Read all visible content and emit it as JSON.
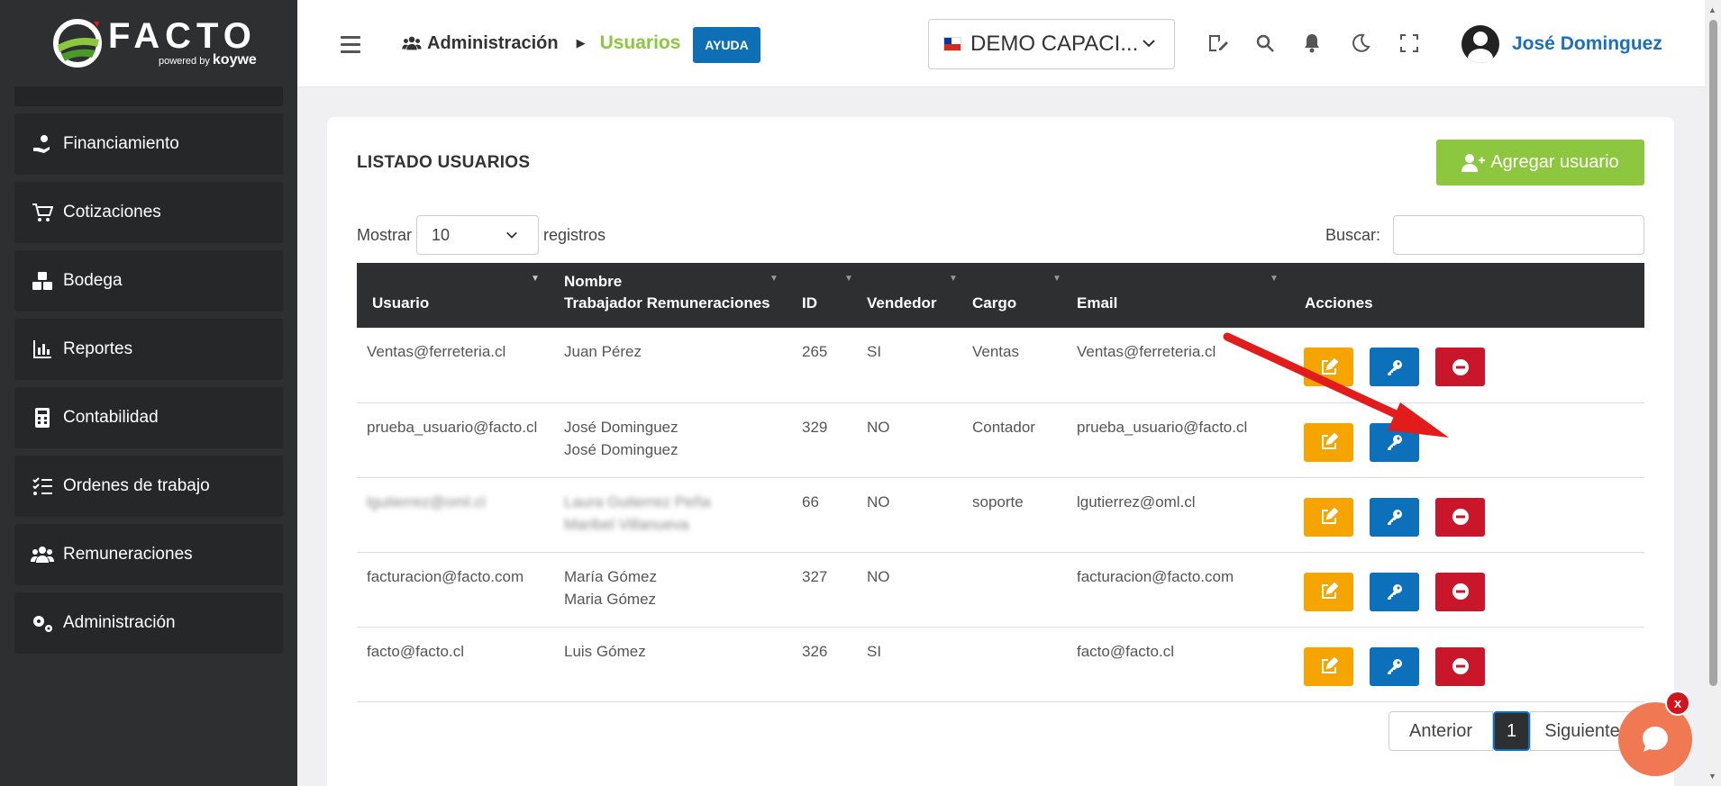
{
  "logo": {
    "name": "FACTO",
    "powered": "powered by",
    "brand": "koywe"
  },
  "sidebar": {
    "items": [
      {
        "label": "Financiamiento",
        "icon": "hand-money-icon"
      },
      {
        "label": "Cotizaciones",
        "icon": "cart-icon"
      },
      {
        "label": "Bodega",
        "icon": "boxes-icon"
      },
      {
        "label": "Reportes",
        "icon": "chart-icon"
      },
      {
        "label": "Contabilidad",
        "icon": "calculator-icon"
      },
      {
        "label": "Ordenes de trabajo",
        "icon": "list-check-icon"
      },
      {
        "label": "Remuneraciones",
        "icon": "users-icon"
      },
      {
        "label": "Administración",
        "icon": "gears-icon"
      }
    ]
  },
  "header": {
    "breadcrumb": {
      "parent": "Administración",
      "current": "Usuarios"
    },
    "help_label": "AYUDA",
    "company": "DEMO CAPACI...",
    "user_name": "José Dominguez"
  },
  "main": {
    "title": "LISTADO USUARIOS",
    "add_label": "Agregar usuario",
    "show_prefix": "Mostrar",
    "show_value": "10",
    "show_suffix": "registros",
    "search_label": "Buscar:",
    "columns": [
      "Usuario",
      "Nombre",
      "Trabajador Remuneraciones",
      "ID",
      "Vendedor",
      "Cargo",
      "Email",
      "Acciones"
    ],
    "rows": [
      {
        "usuario": "Ventas@ferreteria.cl",
        "nombre": "Juan Pérez",
        "trabajador": "",
        "id": "265",
        "vendedor": "SI",
        "cargo": "Ventas",
        "email": "Ventas@ferreteria.cl",
        "blurred": false,
        "deletable": true
      },
      {
        "usuario": "prueba_usuario@facto.cl",
        "nombre": "José Dominguez",
        "trabajador": "José Dominguez",
        "id": "329",
        "vendedor": "NO",
        "cargo": "Contador",
        "email": "prueba_usuario@facto.cl",
        "blurred": false,
        "deletable": false
      },
      {
        "usuario": "lgutierrez@oml.cl",
        "nombre": "Laura Gutierrez Peña",
        "trabajador": "Maribel Villanueva",
        "id": "66",
        "vendedor": "NO",
        "cargo": "soporte",
        "email": "lgutierrez@oml.cl",
        "blurred": true,
        "deletable": true
      },
      {
        "usuario": "facturacion@facto.com",
        "nombre": "María Gómez",
        "trabajador": "Maria Gómez",
        "id": "327",
        "vendedor": "NO",
        "cargo": "",
        "email": "facturacion@facto.com",
        "blurred": false,
        "deletable": true
      },
      {
        "usuario": "facto@facto.cl",
        "nombre": "Luis Gómez",
        "trabajador": "",
        "id": "326",
        "vendedor": "SI",
        "cargo": "",
        "email": "facto@facto.cl",
        "blurred": false,
        "deletable": true
      }
    ],
    "pagination": {
      "prev": "Anterior",
      "current": "1",
      "next": "Siguiente"
    }
  },
  "chat": {
    "close": "x"
  },
  "colors": {
    "accent_green": "#8dc63f",
    "blue": "#0d70bb",
    "edit": "#f6a500",
    "delete": "#c9162b",
    "dark": "#2d2f31",
    "annotation_arrow": "#e21b1b"
  }
}
